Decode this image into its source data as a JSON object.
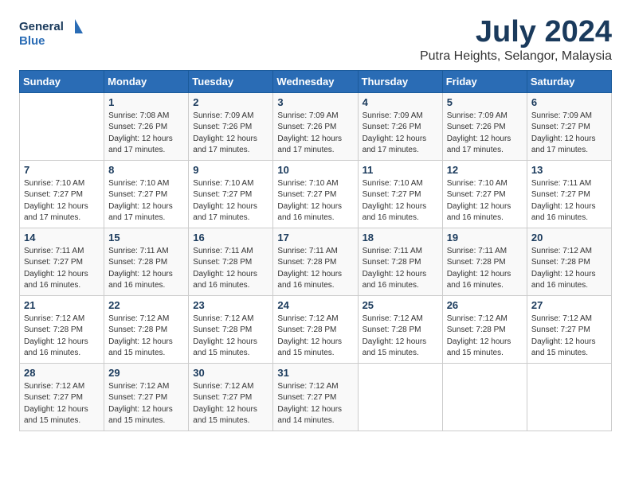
{
  "header": {
    "logo_line1": "General",
    "logo_line2": "Blue",
    "title": "July 2024",
    "subtitle": "Putra Heights, Selangor, Malaysia"
  },
  "weekdays": [
    "Sunday",
    "Monday",
    "Tuesday",
    "Wednesday",
    "Thursday",
    "Friday",
    "Saturday"
  ],
  "weeks": [
    [
      {
        "day": "",
        "info": ""
      },
      {
        "day": "1",
        "info": "Sunrise: 7:08 AM\nSunset: 7:26 PM\nDaylight: 12 hours\nand 17 minutes."
      },
      {
        "day": "2",
        "info": "Sunrise: 7:09 AM\nSunset: 7:26 PM\nDaylight: 12 hours\nand 17 minutes."
      },
      {
        "day": "3",
        "info": "Sunrise: 7:09 AM\nSunset: 7:26 PM\nDaylight: 12 hours\nand 17 minutes."
      },
      {
        "day": "4",
        "info": "Sunrise: 7:09 AM\nSunset: 7:26 PM\nDaylight: 12 hours\nand 17 minutes."
      },
      {
        "day": "5",
        "info": "Sunrise: 7:09 AM\nSunset: 7:26 PM\nDaylight: 12 hours\nand 17 minutes."
      },
      {
        "day": "6",
        "info": "Sunrise: 7:09 AM\nSunset: 7:27 PM\nDaylight: 12 hours\nand 17 minutes."
      }
    ],
    [
      {
        "day": "7",
        "info": "Sunrise: 7:10 AM\nSunset: 7:27 PM\nDaylight: 12 hours\nand 17 minutes."
      },
      {
        "day": "8",
        "info": "Sunrise: 7:10 AM\nSunset: 7:27 PM\nDaylight: 12 hours\nand 17 minutes."
      },
      {
        "day": "9",
        "info": "Sunrise: 7:10 AM\nSunset: 7:27 PM\nDaylight: 12 hours\nand 17 minutes."
      },
      {
        "day": "10",
        "info": "Sunrise: 7:10 AM\nSunset: 7:27 PM\nDaylight: 12 hours\nand 16 minutes."
      },
      {
        "day": "11",
        "info": "Sunrise: 7:10 AM\nSunset: 7:27 PM\nDaylight: 12 hours\nand 16 minutes."
      },
      {
        "day": "12",
        "info": "Sunrise: 7:10 AM\nSunset: 7:27 PM\nDaylight: 12 hours\nand 16 minutes."
      },
      {
        "day": "13",
        "info": "Sunrise: 7:11 AM\nSunset: 7:27 PM\nDaylight: 12 hours\nand 16 minutes."
      }
    ],
    [
      {
        "day": "14",
        "info": "Sunrise: 7:11 AM\nSunset: 7:27 PM\nDaylight: 12 hours\nand 16 minutes."
      },
      {
        "day": "15",
        "info": "Sunrise: 7:11 AM\nSunset: 7:28 PM\nDaylight: 12 hours\nand 16 minutes."
      },
      {
        "day": "16",
        "info": "Sunrise: 7:11 AM\nSunset: 7:28 PM\nDaylight: 12 hours\nand 16 minutes."
      },
      {
        "day": "17",
        "info": "Sunrise: 7:11 AM\nSunset: 7:28 PM\nDaylight: 12 hours\nand 16 minutes."
      },
      {
        "day": "18",
        "info": "Sunrise: 7:11 AM\nSunset: 7:28 PM\nDaylight: 12 hours\nand 16 minutes."
      },
      {
        "day": "19",
        "info": "Sunrise: 7:11 AM\nSunset: 7:28 PM\nDaylight: 12 hours\nand 16 minutes."
      },
      {
        "day": "20",
        "info": "Sunrise: 7:12 AM\nSunset: 7:28 PM\nDaylight: 12 hours\nand 16 minutes."
      }
    ],
    [
      {
        "day": "21",
        "info": "Sunrise: 7:12 AM\nSunset: 7:28 PM\nDaylight: 12 hours\nand 16 minutes."
      },
      {
        "day": "22",
        "info": "Sunrise: 7:12 AM\nSunset: 7:28 PM\nDaylight: 12 hours\nand 15 minutes."
      },
      {
        "day": "23",
        "info": "Sunrise: 7:12 AM\nSunset: 7:28 PM\nDaylight: 12 hours\nand 15 minutes."
      },
      {
        "day": "24",
        "info": "Sunrise: 7:12 AM\nSunset: 7:28 PM\nDaylight: 12 hours\nand 15 minutes."
      },
      {
        "day": "25",
        "info": "Sunrise: 7:12 AM\nSunset: 7:28 PM\nDaylight: 12 hours\nand 15 minutes."
      },
      {
        "day": "26",
        "info": "Sunrise: 7:12 AM\nSunset: 7:28 PM\nDaylight: 12 hours\nand 15 minutes."
      },
      {
        "day": "27",
        "info": "Sunrise: 7:12 AM\nSunset: 7:27 PM\nDaylight: 12 hours\nand 15 minutes."
      }
    ],
    [
      {
        "day": "28",
        "info": "Sunrise: 7:12 AM\nSunset: 7:27 PM\nDaylight: 12 hours\nand 15 minutes."
      },
      {
        "day": "29",
        "info": "Sunrise: 7:12 AM\nSunset: 7:27 PM\nDaylight: 12 hours\nand 15 minutes."
      },
      {
        "day": "30",
        "info": "Sunrise: 7:12 AM\nSunset: 7:27 PM\nDaylight: 12 hours\nand 15 minutes."
      },
      {
        "day": "31",
        "info": "Sunrise: 7:12 AM\nSunset: 7:27 PM\nDaylight: 12 hours\nand 14 minutes."
      },
      {
        "day": "",
        "info": ""
      },
      {
        "day": "",
        "info": ""
      },
      {
        "day": "",
        "info": ""
      }
    ]
  ]
}
